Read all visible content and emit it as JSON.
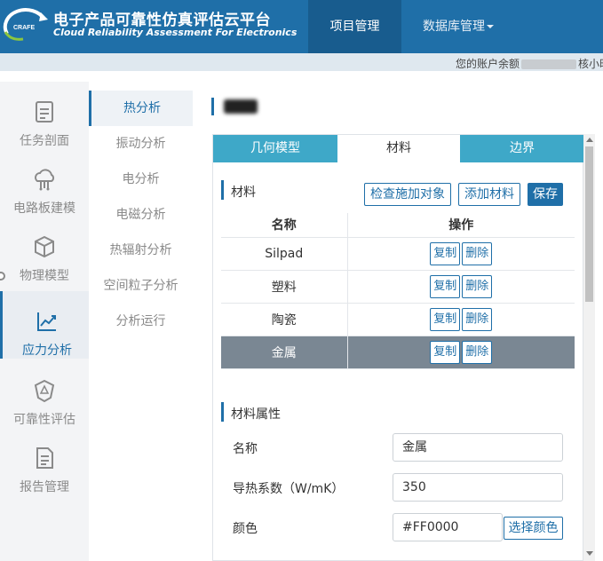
{
  "header": {
    "logo_text": "CRAFE",
    "brand_cn": "电子产品可靠性仿真评估云平台",
    "brand_en": "Cloud Reliability Assessment For Electronics",
    "nav": [
      {
        "label": "项目管理"
      },
      {
        "label": "数据库管理"
      }
    ]
  },
  "notice": {
    "prefix": "您的账户余额",
    "suffix": "核小时"
  },
  "sidebar": {
    "items": [
      {
        "label": "任务剖面",
        "icon": "clipboard-icon"
      },
      {
        "label": "电路板建模",
        "icon": "circuit-cloud-icon"
      },
      {
        "label": "物理模型",
        "icon": "cube-icon"
      },
      {
        "label": "应力分析",
        "icon": "line-chart-icon"
      },
      {
        "label": "可靠性评估",
        "icon": "shield-icon"
      },
      {
        "label": "报告管理",
        "icon": "document-icon"
      }
    ]
  },
  "subsidebar": {
    "items": [
      {
        "label": "热分析"
      },
      {
        "label": "振动分析"
      },
      {
        "label": "电分析"
      },
      {
        "label": "电磁分析"
      },
      {
        "label": "热辐射分析"
      },
      {
        "label": "空间粒子分析"
      },
      {
        "label": "分析运行"
      }
    ]
  },
  "panel": {
    "tabs": [
      {
        "label": "几何模型"
      },
      {
        "label": "材料"
      },
      {
        "label": "边界"
      }
    ],
    "materials_section": {
      "title": "材料",
      "btn_check": "检查施加对象",
      "btn_add": "添加材料",
      "btn_save": "保存",
      "columns": [
        "名称",
        "操作"
      ],
      "rows": [
        {
          "name": "Silpad",
          "copy": "复制",
          "delete": "删除"
        },
        {
          "name": "塑料",
          "copy": "复制",
          "delete": "删除"
        },
        {
          "name": "陶瓷",
          "copy": "复制",
          "delete": "删除"
        },
        {
          "name": "金属",
          "copy": "复制",
          "delete": "删除"
        }
      ]
    },
    "props_section": {
      "title": "材料属性",
      "name_label": "名称",
      "name_value": "金属",
      "conductivity_label": "导热系数（W/mK）",
      "conductivity_value": "350",
      "color_label": "颜色",
      "color_value": "#FF0000",
      "color_button": "选择颜色"
    }
  },
  "colors": {
    "header": "#1f6fa8",
    "tab": "#3ea8c8",
    "selected_row": "#7a8793"
  }
}
